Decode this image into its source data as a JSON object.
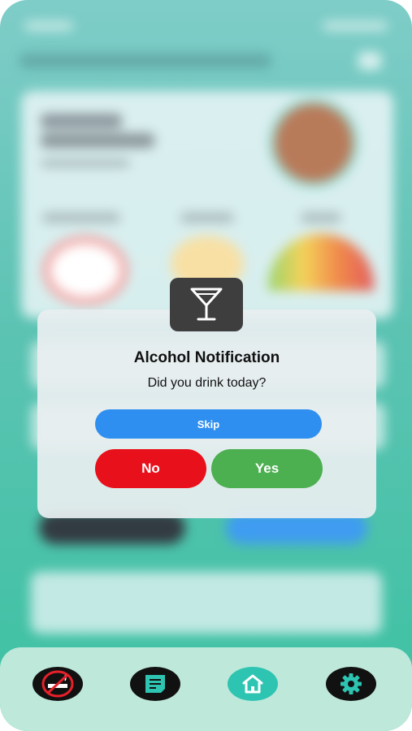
{
  "dialog": {
    "icon": "cocktail-glass-icon",
    "title": "Alcohol Notification",
    "message": "Did you drink today?",
    "skip_label": "Skip",
    "no_label": "No",
    "yes_label": "Yes"
  },
  "bottom_nav": {
    "items": [
      {
        "icon": "no-smoking-icon"
      },
      {
        "icon": "notes-icon"
      },
      {
        "icon": "home-icon",
        "active": true
      },
      {
        "icon": "gear-icon"
      }
    ]
  },
  "colors": {
    "skip": "#2f8ff0",
    "no": "#e8101a",
    "yes": "#4caf50",
    "nav_active": "#2ec4b2",
    "nav_icon": "#2ec4b2"
  }
}
